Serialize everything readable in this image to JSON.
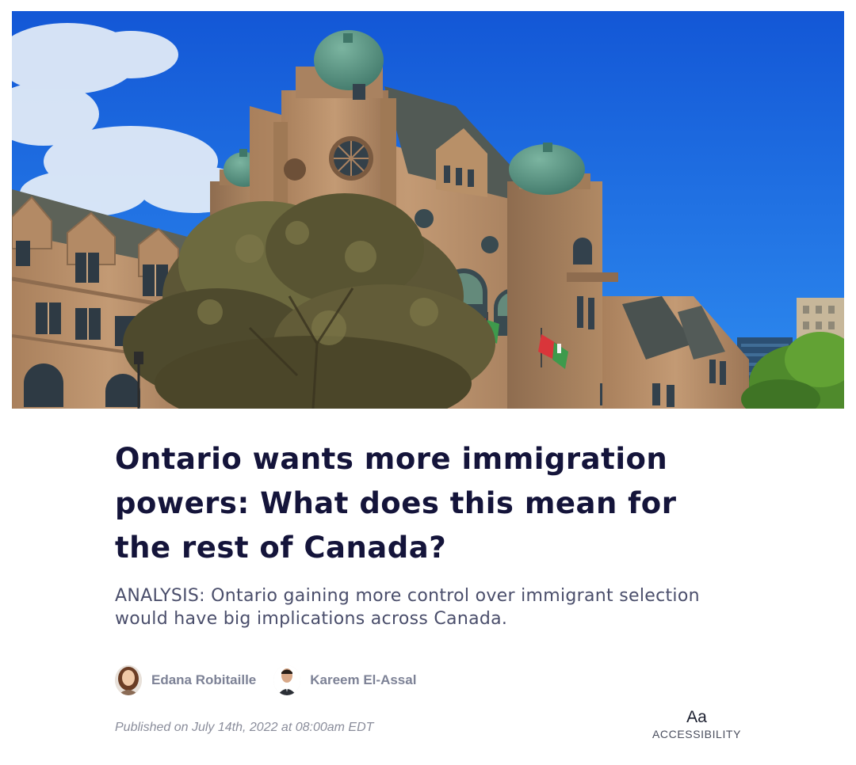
{
  "hero": {
    "image": "ontario-legislative-building-photo"
  },
  "article": {
    "title": "Ontario wants more immigration powers: What does this mean for the rest of Canada?",
    "subtitle": "ANALYSIS: Ontario gaining more control over immigrant selection would have big implications across Canada.",
    "authors": [
      {
        "name": "Edana Robitaille",
        "avatar": "edana-avatar"
      },
      {
        "name": "Kareem El-Assal",
        "avatar": "kareem-avatar"
      }
    ],
    "published": "Published on July 14th, 2022 at 08:00am EDT"
  },
  "accessibility": {
    "icon_text": "Aa",
    "label": "ACCESSIBILITY"
  },
  "colors": {
    "title": "#14143a",
    "subtitle": "#4a4e6b",
    "meta": "#8a8d9b",
    "sky": "#1a6fe0",
    "sandstone": "#b88e67"
  }
}
